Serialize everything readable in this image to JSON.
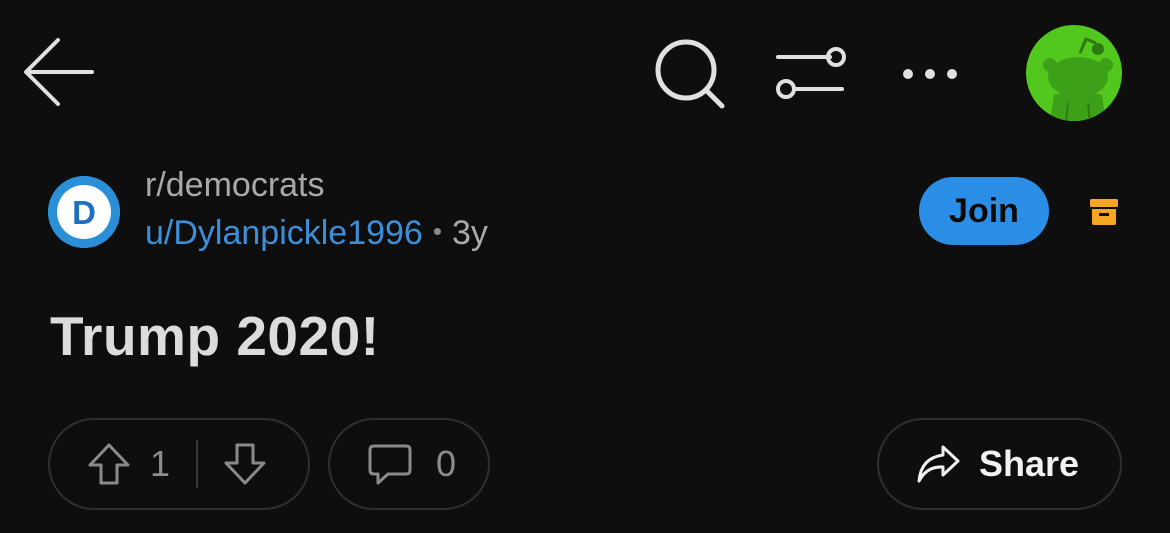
{
  "icons": {
    "back": "arrow-left-icon",
    "search": "search-icon",
    "filter": "sort-filter-icon",
    "more": "more-dots-icon",
    "avatar": "reddit-snoo-avatar",
    "subreddit_logo": "democrats-d-logo",
    "archive": "archive-icon",
    "upvote": "upvote-arrow-icon",
    "downvote": "downvote-arrow-icon",
    "comment": "comment-bubble-icon",
    "share": "share-arrow-icon"
  },
  "colors": {
    "background": "#0e0e0e",
    "link": "#3c8fd8",
    "join": "#2b8ee6",
    "avatar": "#52c81f",
    "archive": "#f5a623"
  },
  "post": {
    "subreddit": "r/democrats",
    "author": "u/Dylanpickle1996",
    "separator": "•",
    "age": "3y",
    "title": "Trump 2020!",
    "join_label": "Join",
    "logo_letter": "D"
  },
  "actions": {
    "votes": "1",
    "comments": "0",
    "share_label": "Share"
  }
}
